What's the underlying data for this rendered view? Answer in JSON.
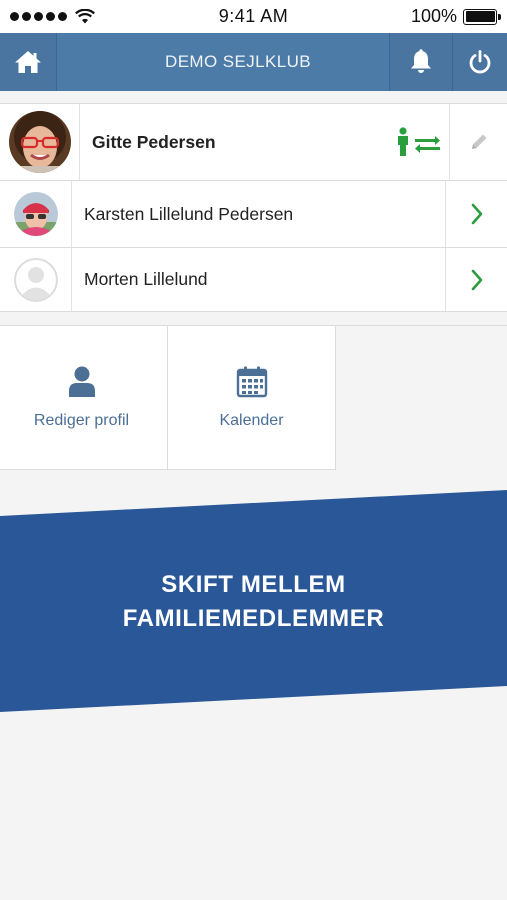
{
  "status_bar": {
    "time": "9:41 AM",
    "battery": "100%",
    "signal_icon": "signal-dots-icon",
    "wifi_icon": "wifi-icon"
  },
  "header": {
    "title": "DEMO SEJLKLUB",
    "home_icon": "home-icon",
    "bell_icon": "bell-icon",
    "power_icon": "power-icon",
    "color": "#4d7ba7"
  },
  "members": [
    {
      "name": "Gitte Pedersen",
      "active": true,
      "actions": [
        "switch-user-icon",
        "pencil-icon"
      ]
    },
    {
      "name": "Karsten Lillelund Pedersen",
      "active": false,
      "actions": [
        "chevron-right-icon"
      ]
    },
    {
      "name": "Morten Lillelund",
      "active": false,
      "actions": [
        "chevron-right-icon"
      ]
    }
  ],
  "tiles": [
    {
      "label": "Rediger profil",
      "icon": "user-icon"
    },
    {
      "label": "Kalender",
      "icon": "calendar-icon"
    }
  ],
  "banner": {
    "line1": "SKIFT MELLEM",
    "line2": "FAMILIEMEDLEMMER",
    "color": "#2a5797"
  },
  "colors": {
    "accent_green": "#2a9d3c",
    "tile_text": "#4b6f95"
  }
}
